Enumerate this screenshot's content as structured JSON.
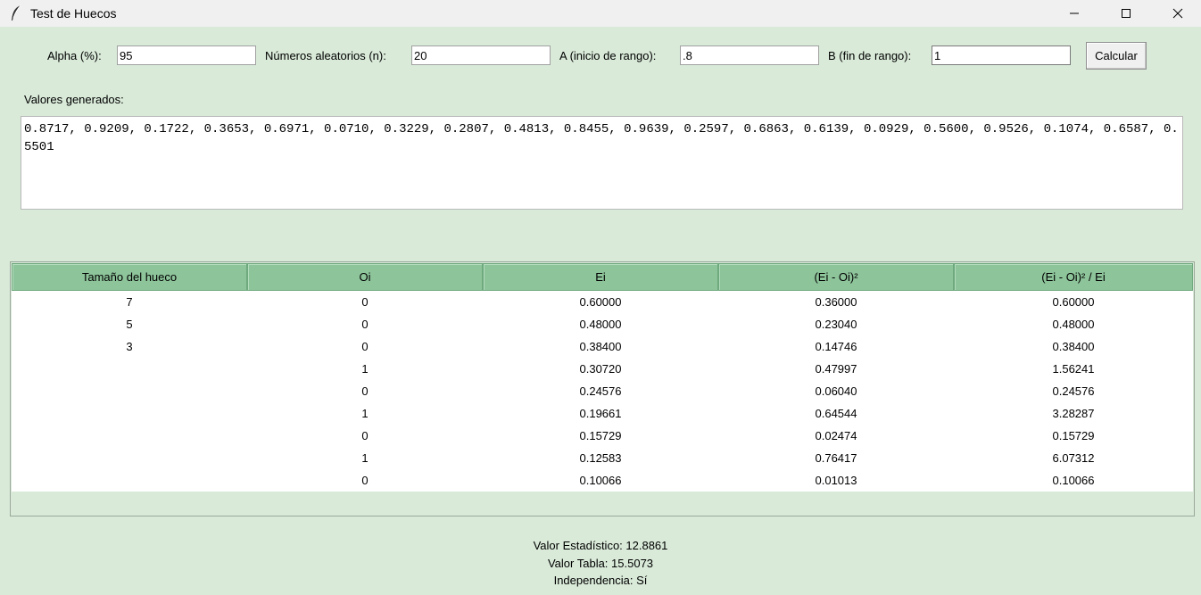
{
  "window": {
    "title": "Test de Huecos"
  },
  "form": {
    "alpha": {
      "label": "Alpha (%):",
      "value": "95"
    },
    "n": {
      "label": "Números aleatorios (n):",
      "value": "20"
    },
    "a": {
      "label": "A (inicio de rango):",
      "value": ".8"
    },
    "b": {
      "label": "B (fin de rango):",
      "value": "1"
    },
    "calculate_label": "Calcular"
  },
  "generated": {
    "label": "Valores generados:",
    "text": "0.8717, 0.9209, 0.1722, 0.3653, 0.6971, 0.0710, 0.3229, 0.2807, 0.4813, 0.8455, 0.9639, 0.2597, 0.6863, 0.6139, 0.0929, 0.5600, 0.9526, 0.1074, 0.6587, 0.5501"
  },
  "table": {
    "columns": [
      "Tamaño del hueco",
      "Oi",
      "Ei",
      "(Ei - Oi)²",
      "(Ei - Oi)² / Ei"
    ],
    "rows": [
      [
        "7",
        "0",
        "0.60000",
        "0.36000",
        "0.60000"
      ],
      [
        "5",
        "0",
        "0.48000",
        "0.23040",
        "0.48000"
      ],
      [
        "3",
        "0",
        "0.38400",
        "0.14746",
        "0.38400"
      ],
      [
        "",
        "1",
        "0.30720",
        "0.47997",
        "1.56241"
      ],
      [
        "",
        "0",
        "0.24576",
        "0.06040",
        "0.24576"
      ],
      [
        "",
        "1",
        "0.19661",
        "0.64544",
        "3.28287"
      ],
      [
        "",
        "0",
        "0.15729",
        "0.02474",
        "0.15729"
      ],
      [
        "",
        "1",
        "0.12583",
        "0.76417",
        "6.07312"
      ],
      [
        "",
        "0",
        "0.10066",
        "0.01013",
        "0.10066"
      ]
    ]
  },
  "results": {
    "statistic": "Valor Estadístico: 12.8861",
    "table_value": "Valor Tabla: 15.5073",
    "independence": "Independencia: Sí"
  }
}
